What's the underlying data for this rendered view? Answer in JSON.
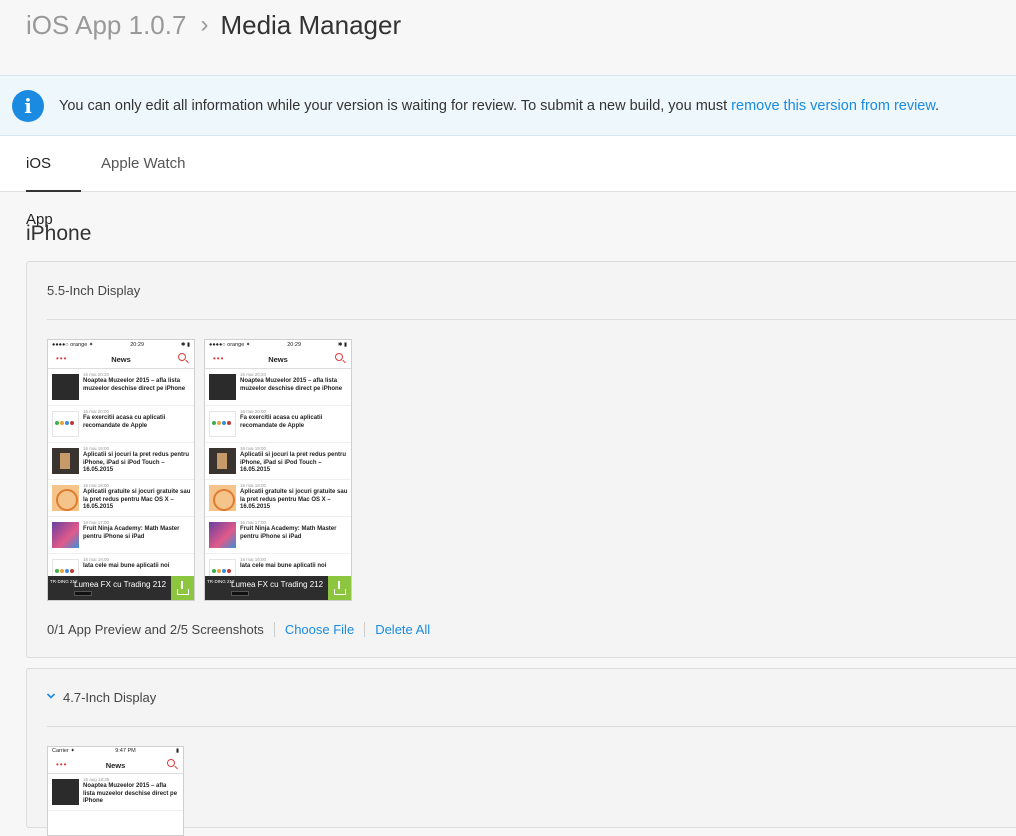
{
  "breadcrumb": {
    "parent": "iOS App 1.0.7",
    "separator": "›",
    "current": "Media Manager"
  },
  "banner": {
    "text": "You can only edit all information while your version is waiting for review. To submit a new build, you must ",
    "link": "remove this version from review",
    "suffix": "."
  },
  "tabs": [
    {
      "label": "iOS App",
      "active": true
    },
    {
      "label": "Apple Watch",
      "active": false
    }
  ],
  "section_title": "iPhone",
  "panel_55": {
    "title": "5.5-Inch Display",
    "screenshots": [
      {
        "status_left": "●●●●○ orange ✦",
        "status_time": "20:29",
        "status_right": "✱ ▮",
        "nav_dots": "•••",
        "nav_title": "News",
        "items": [
          {
            "meta": "16 mai 20:20",
            "title": "Noaptea Muzeelor 2015 – afla lista muzeelor deschise direct pe iPhone",
            "img": "dark"
          },
          {
            "meta": "16 mai 20:00",
            "title": "Fa exercitii acasa cu aplicatii recomandate de Apple",
            "img": "dots"
          },
          {
            "meta": "16 mai 19:00",
            "title": "Aplicatii si jocuri la pret redus pentru iPhone, iPad si iPod Touch – 16.05.2015",
            "img": "brown"
          },
          {
            "meta": "16 mai 18:00",
            "title": "Aplicatii gratuite si jocuri gratuite sau la pret redus pentru Mac OS X – 16.05.2015",
            "img": "orange"
          },
          {
            "meta": "16 mai 17:00",
            "title": "Fruit Ninja Academy: Math Master pentru iPhone si iPad",
            "img": "purple"
          },
          {
            "meta": "16 mai 16:00",
            "title": "Iata cele mai bune aplicatii noi",
            "img": "dots"
          }
        ],
        "ad_logo": "TR·DING 212",
        "ad_text": "Lumea FX cu Trading 212"
      },
      {
        "status_left": "●●●●○ orange ✦",
        "status_time": "20:29",
        "status_right": "✱ ▮",
        "nav_dots": "•••",
        "nav_title": "News",
        "items": [
          {
            "meta": "16 mai 20:20",
            "title": "Noaptea Muzeelor 2015 – afla lista muzeelor deschise direct pe iPhone",
            "img": "dark"
          },
          {
            "meta": "16 mai 20:00",
            "title": "Fa exercitii acasa cu aplicatii recomandate de Apple",
            "img": "dots"
          },
          {
            "meta": "16 mai 19:00",
            "title": "Aplicatii si jocuri la pret redus pentru iPhone, iPad si iPod Touch – 16.05.2015",
            "img": "brown"
          },
          {
            "meta": "16 mai 18:00",
            "title": "Aplicatii gratuite si jocuri gratuite sau la pret redus pentru Mac OS X – 16.05.2015",
            "img": "orange"
          },
          {
            "meta": "16 mai 17:00",
            "title": "Fruit Ninja Academy: Math Master pentru iPhone si iPad",
            "img": "purple"
          },
          {
            "meta": "16 mai 16:00",
            "title": "Iata cele mai bune aplicatii noi",
            "img": "dots"
          }
        ],
        "ad_logo": "TR·DING 212",
        "ad_text": "Lumea FX cu Trading 212"
      }
    ],
    "footer_count": "0/1 App Preview and 2/5 Screenshots",
    "choose_file": "Choose File",
    "delete_all": "Delete All"
  },
  "panel_47": {
    "title": "4.7-Inch Display",
    "screenshot": {
      "status_left": "Carrier ✦",
      "status_time": "9:47 PM",
      "status_right": "▮",
      "nav_dots": "•••",
      "nav_title": "News",
      "item_meta": "16 aug 19:35",
      "item_title": "Noaptea Muzeelor 2015 – afla lista muzeelor deschise direct pe iPhone"
    }
  },
  "colors": {
    "link": "#1a8be0",
    "info_icon": "#1a8be0",
    "banner_bg": "#eef7fc",
    "download_green": "#8cc63e"
  },
  "icons": {
    "info": "info-icon",
    "chevron": "chevron-down-icon"
  }
}
